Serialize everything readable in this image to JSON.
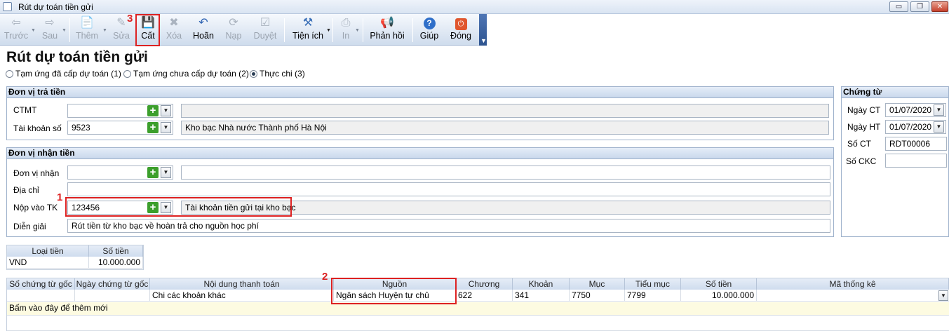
{
  "window": {
    "title": "Rút dự toán tiền gửi",
    "controls": [
      "▭",
      "❐",
      "✕"
    ]
  },
  "toolbar": {
    "buttons": [
      {
        "label": "Trước",
        "icon": "arrow-left-icon",
        "glyph": "⇦"
      },
      {
        "label": "Sau",
        "icon": "arrow-right-icon",
        "glyph": "⇨"
      },
      {
        "label": "Thêm",
        "icon": "add-document-icon",
        "glyph": "📄"
      },
      {
        "label": "Sửa",
        "icon": "edit-document-icon",
        "glyph": "✎"
      },
      {
        "label": "Cất",
        "icon": "save-icon",
        "glyph": "💾"
      },
      {
        "label": "Xóa",
        "icon": "delete-document-icon",
        "glyph": "✖"
      },
      {
        "label": "Hoãn",
        "icon": "undo-icon",
        "glyph": "↶"
      },
      {
        "label": "Nạp",
        "icon": "reload-icon",
        "glyph": "⟳"
      },
      {
        "label": "Duyệt",
        "icon": "approve-icon",
        "glyph": "☑"
      },
      {
        "label": "Tiện ích",
        "icon": "tools-icon",
        "glyph": "⚒"
      },
      {
        "label": "In",
        "icon": "print-icon",
        "glyph": "⎙"
      },
      {
        "label": "Phản hồi",
        "icon": "megaphone-icon",
        "glyph": "📢"
      },
      {
        "label": "Giúp",
        "icon": "help-icon",
        "glyph": "?"
      },
      {
        "label": "Đóng",
        "icon": "close-icon",
        "glyph": "⏻"
      }
    ]
  },
  "annotations": {
    "n1": "1",
    "n2": "2",
    "n3": "3"
  },
  "page_title": "Rút dự toán tiền gửi",
  "radios": [
    {
      "label": "Tạm ứng đã cấp dự toán (1)",
      "checked": false
    },
    {
      "label": "Tạm ứng chưa cấp dự toán (2)",
      "checked": false
    },
    {
      "label": "Thực chi (3)",
      "checked": true
    }
  ],
  "payer": {
    "title": "Đơn vị trả tiền",
    "ctmt_label": "CTMT",
    "ctmt_value": "",
    "ctmt_desc": "",
    "account_label": "Tài khoản số",
    "account_value": "9523",
    "account_desc": "Kho bạc Nhà nước Thành phố Hà Nội"
  },
  "payee": {
    "title": "Đơn vị nhận tiền",
    "unit_label": "Đơn vị nhận",
    "unit_value": "",
    "unit_desc": "",
    "address_label": "Địa chỉ",
    "address_value": "",
    "deposit_label": "Nộp vào TK",
    "deposit_value": "123456",
    "deposit_desc": "Tài khoản tiền gửi tại kho bạc",
    "explain_label": "Diễn giải",
    "explain_value": "Rút tiền từ kho bạc về hoàn trả cho nguồn học phí"
  },
  "voucher": {
    "title": "Chứng từ",
    "date_ct_label": "Ngày CT",
    "date_ct": "01/07/2020",
    "date_ht_label": "Ngày HT",
    "date_ht": "01/07/2020",
    "no_label": "Số CT",
    "no_value": "RDT00006",
    "ckc_label": "Số CKC",
    "ckc_value": ""
  },
  "currency_grid": {
    "headers": [
      "Loại tiền",
      "Số tiền"
    ],
    "rows": [
      [
        "VND",
        "10.000.000"
      ]
    ]
  },
  "detail_grid": {
    "headers": [
      "Số chứng từ gốc",
      "Ngày chứng từ gốc",
      "Nội dung thanh toán",
      "Nguồn",
      "Chương",
      "Khoản",
      "Mục",
      "Tiểu mục",
      "Số tiền",
      "Mã thống kê"
    ],
    "row": [
      "",
      "",
      "Chi các khoản khác",
      "Ngân sách Huyện tự chủ",
      "622",
      "341",
      "7750",
      "7799",
      "10.000.000",
      ""
    ],
    "add_hint": "Bấm vào đây để thêm mới"
  }
}
